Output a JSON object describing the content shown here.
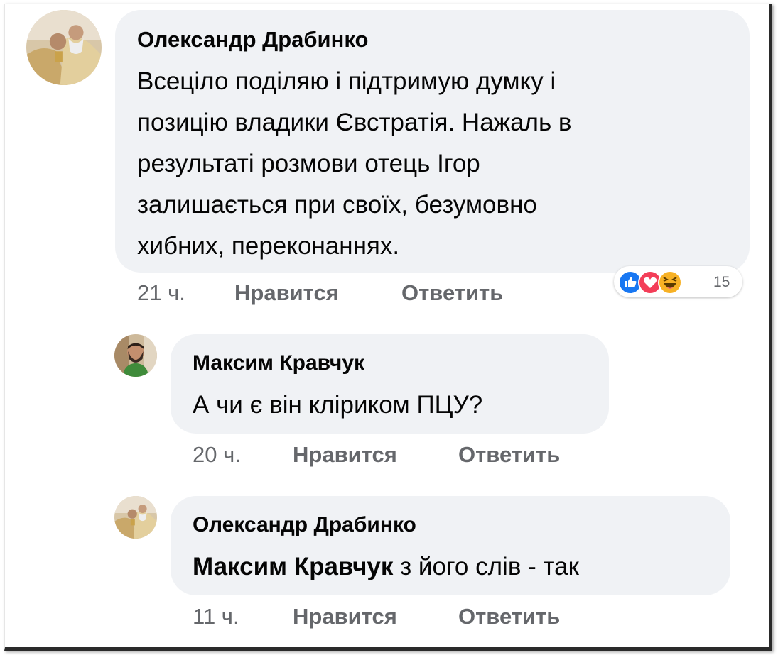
{
  "comment": {
    "author": "Олександр Драбинко",
    "lines": [
      "Всеціло поділяю і підтримую думку і",
      "позицію владики Євстратія. Нажаль в",
      "результаті розмови отець Ігор",
      "залишається при своїх, безумовно",
      "хибних, переконаннях."
    ],
    "time": "21 ч.",
    "like_label": "Нравится",
    "reply_label": "Ответить",
    "reaction_count": "15",
    "reaction_icons": [
      "like-icon",
      "love-icon",
      "haha-icon"
    ]
  },
  "replies": [
    {
      "author": "Максим Кравчук",
      "text": "А чи є він кліриком ПЦУ?",
      "time": "20 ч.",
      "like_label": "Нравится",
      "reply_label": "Ответить"
    },
    {
      "author": "Олександр Драбинко",
      "mention": "Максим Кравчук",
      "text": "з його слів - так",
      "time": "11 ч.",
      "like_label": "Нравится",
      "reply_label": "Ответить"
    }
  ],
  "colors": {
    "bubble": "#f0f2f5",
    "text": "#050505",
    "meta": "#65676b",
    "like_blue": "#1877f2",
    "love_red": "#f33e58",
    "haha_yellow": "#f7b125"
  }
}
